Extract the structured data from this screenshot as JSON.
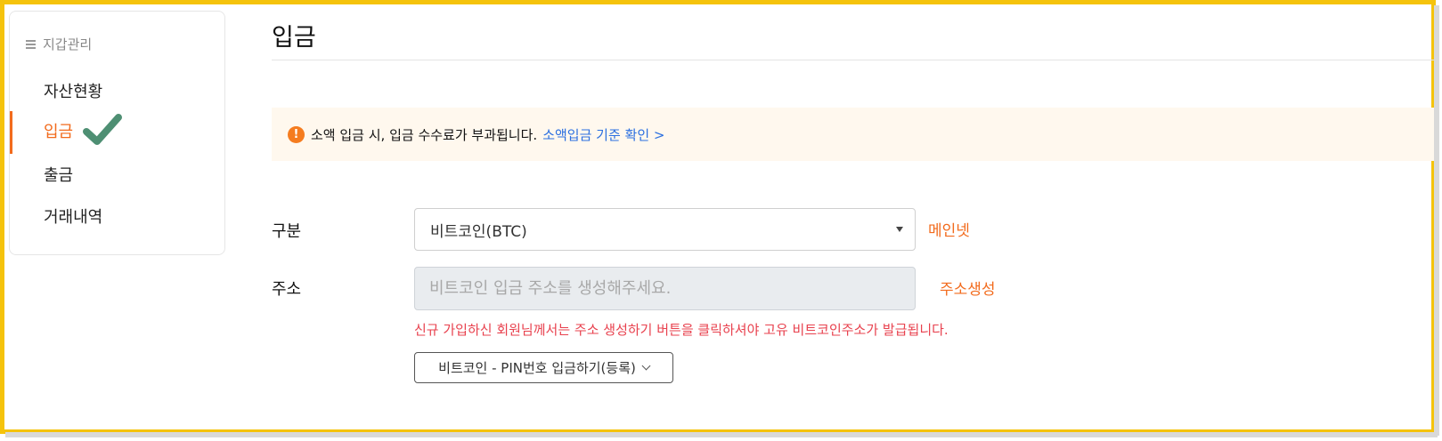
{
  "sidebar": {
    "title": "지갑관리",
    "items": [
      {
        "label": "자산현황"
      },
      {
        "label": "입금"
      },
      {
        "label": "출금"
      },
      {
        "label": "거래내역"
      }
    ],
    "active_index": 1
  },
  "page": {
    "title": "입금"
  },
  "notice": {
    "icon": "!",
    "text": "소액 입금 시, 입금 수수료가 부과됩니다.",
    "link": "소액입금 기준 확인 >"
  },
  "form": {
    "type_label": "구분",
    "coin_select": "비트코인(BTC)",
    "network": "메인넷",
    "address_label": "주소",
    "address_placeholder": "비트코인 입금 주소를 생성해주세요.",
    "generate_button": "주소생성",
    "warning": "신규 가입하신 회원님께서는 주소 생성하기 버튼을 클릭하셔야 고유 비트코인주소가 발급됩니다.",
    "pin_button": "비트코인 - PIN번호 입금하기(등록)"
  },
  "colors": {
    "accent": "#f26b1d",
    "link": "#2b6fe0",
    "warning": "#e8414e",
    "frame": "#f5c30c",
    "check": "#4e8f73"
  }
}
